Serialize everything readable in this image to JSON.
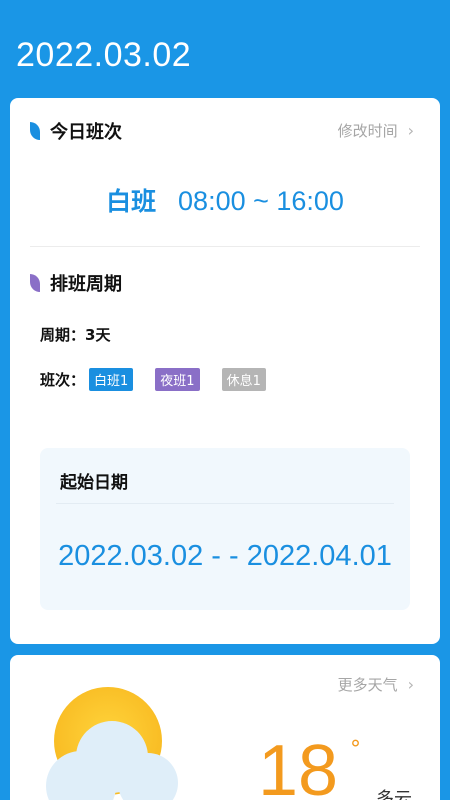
{
  "header": {
    "date": "2022.03.02"
  },
  "today_shift": {
    "title": "今日班次",
    "edit_label": "修改时间",
    "shift_name": "白班",
    "shift_time": "08:00 ~ 16:00"
  },
  "schedule": {
    "title": "排班周期",
    "period_label": "周期：",
    "period_value": "3天",
    "shifts_label": "班次：",
    "tags": [
      {
        "label": "白班1",
        "color": "#1a8fe0"
      },
      {
        "label": "夜班1",
        "color": "#8a6fc7"
      },
      {
        "label": "休息1",
        "color": "#b5b5b5"
      }
    ],
    "start_title": "起始日期",
    "start_range": "2022.03.02 - - 2022.04.01"
  },
  "weather": {
    "more_label": "更多天气",
    "temperature": "18",
    "degree": "°",
    "condition": "多云",
    "icon": "partly-cloudy-icon"
  },
  "colors": {
    "background": "#1a96e6",
    "accent": "#1a8fe0",
    "purple": "#8a6fc7",
    "gray": "#b5b5b5",
    "temperature": "#f39a1e"
  }
}
